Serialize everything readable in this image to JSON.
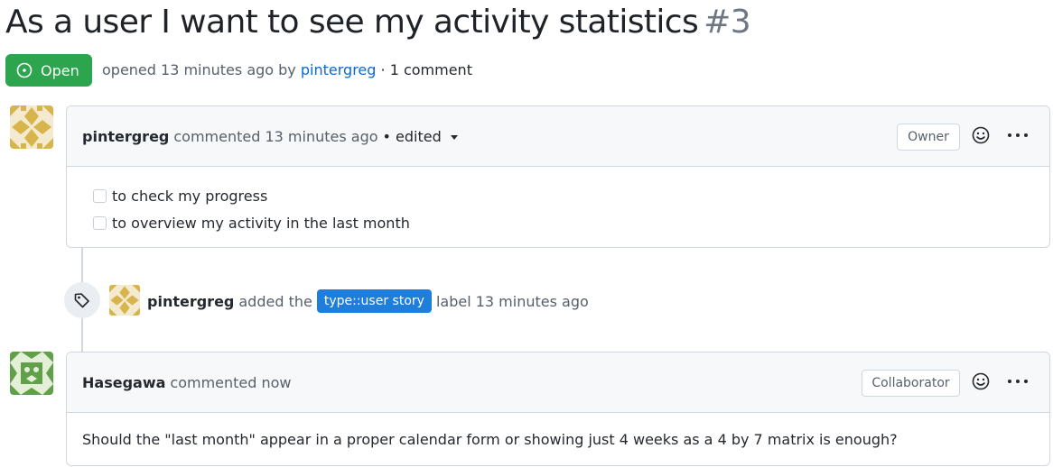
{
  "issue": {
    "title": "As a user I want to see my activity statistics",
    "number": "#3",
    "state": "Open",
    "state_color": "#2da44e",
    "meta_opened": "opened 13 minutes ago by",
    "meta_author": "pintergreg",
    "meta_comments": "· 1 comment"
  },
  "comments": [
    {
      "author": "pintergreg",
      "action": "commented 13 minutes ago",
      "edited": "• edited",
      "role": "Owner",
      "tasks": [
        "to check my progress",
        "to overview my activity in the last month"
      ]
    },
    {
      "author": "Hasegawa",
      "action": "commented now",
      "role": "Collaborator",
      "body": "Should the \"last month\" appear in a proper calendar form or showing just 4 weeks as a 4 by 7 matrix is enough?"
    }
  ],
  "event": {
    "author": "pintergreg",
    "action": "added the",
    "label": "type::user story",
    "label_color": "#1f7ddc",
    "suffix": "label 13 minutes ago"
  }
}
